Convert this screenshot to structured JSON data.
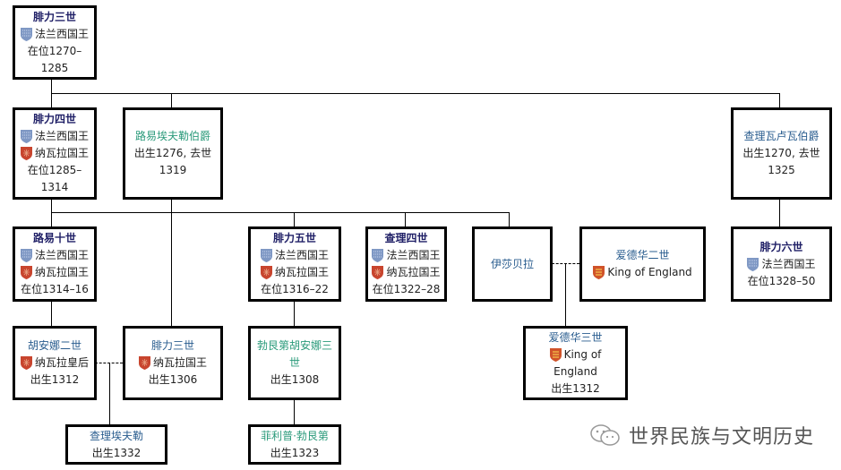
{
  "colors": {
    "france_shield": "#7f98c4",
    "navarre_shield": "#c8452e",
    "england_shield": "#d0532a",
    "name_bold": "#1f1f66",
    "name_link": "#2a5d8f",
    "name_green": "#2a9a7a"
  },
  "titles": {
    "france": "法兰西国王",
    "navarre": "纳瓦拉国王",
    "navarre_queen": "纳瓦拉皇后",
    "england": "King of England"
  },
  "nodes": {
    "philip3": {
      "name": "腓力三世",
      "icons": [
        "france-shield-icon"
      ],
      "lines": [
        "在位1270–",
        "1285"
      ]
    },
    "philip4": {
      "name": "腓力四世",
      "lines": [
        "在位1285–",
        "1314"
      ]
    },
    "louis_evreux": {
      "name": "路易埃夫勒伯爵",
      "lines": [
        "出生1276, 去世",
        "1319"
      ]
    },
    "charles_valois": {
      "name": "查理瓦卢瓦伯爵",
      "lines": [
        "出生1270, 去世",
        "1325"
      ]
    },
    "louis10": {
      "name": "路易十世",
      "lines": [
        "在位1314–16"
      ]
    },
    "philip5": {
      "name": "腓力五世",
      "lines": [
        "在位1316–22"
      ]
    },
    "charles4": {
      "name": "查理四世",
      "lines": [
        "在位1322–28"
      ]
    },
    "isabella": {
      "name": "伊莎贝拉"
    },
    "edward2": {
      "name": "爱德华二世"
    },
    "philip6": {
      "name": "腓力六世",
      "lines": [
        "在位1328–50"
      ]
    },
    "joan2": {
      "name": "胡安娜二世",
      "lines": [
        "出生1312"
      ]
    },
    "philip3_navarre": {
      "name": "腓力三世",
      "lines": [
        "出生1306"
      ]
    },
    "joan3_burgundy": {
      "name": "勃艮第胡安娜三世",
      "lines": [
        "出生1308"
      ]
    },
    "edward3": {
      "name": "爱德华三世",
      "title_a": "King of",
      "title_b": "England",
      "lines": [
        "出生1312"
      ]
    },
    "charles_evreux": {
      "name": "查理埃夫勒",
      "lines": [
        "出生1332"
      ]
    },
    "philip_burgundy": {
      "name": "菲利普·勃艮第",
      "lines": [
        "出生1323"
      ]
    }
  },
  "watermark": {
    "text": "世界民族与文明历史",
    "icon": "wechat-icon"
  }
}
